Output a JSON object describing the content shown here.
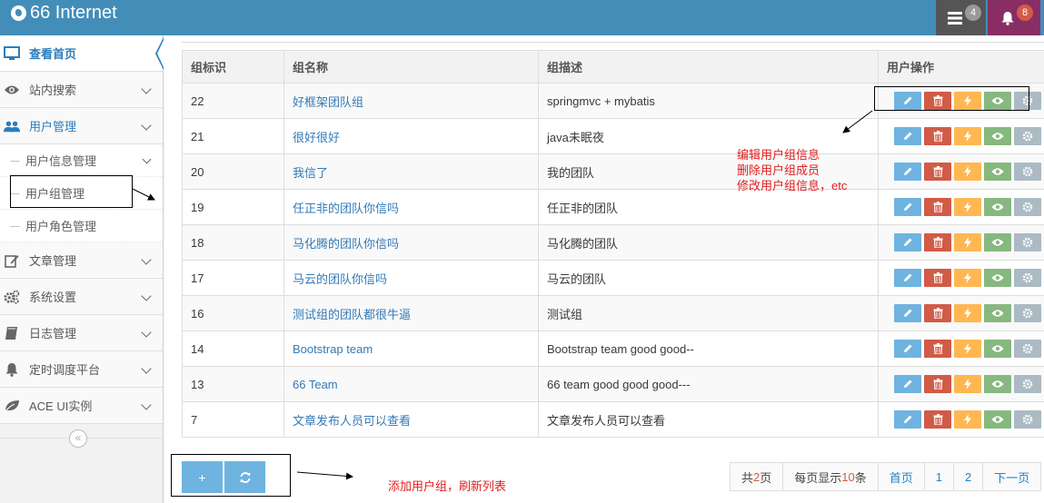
{
  "navbar": {
    "brand": "66 Internet",
    "tasks_badge": "4",
    "alerts_badge": "8",
    "colors": {
      "bar": "#438eb9",
      "tasks": "#555555",
      "alerts": "#892e65"
    }
  },
  "sidebar": {
    "items": [
      {
        "label": "查看首页",
        "icon": "monitor-icon"
      },
      {
        "label": "站内搜索",
        "icon": "eye-icon"
      },
      {
        "label": "用户管理",
        "icon": "users-icon"
      },
      {
        "label": "用户信息管理"
      },
      {
        "label": "用户组管理"
      },
      {
        "label": "用户角色管理"
      },
      {
        "label": "文章管理",
        "icon": "edit-icon"
      },
      {
        "label": "系统设置",
        "icon": "cogs-icon"
      },
      {
        "label": "日志管理",
        "icon": "book-icon"
      },
      {
        "label": "定时调度平台",
        "icon": "bell-icon"
      },
      {
        "label": "ACE UI实例",
        "icon": "leaf-icon"
      }
    ],
    "collapse_glyph": "«"
  },
  "table": {
    "headers": [
      "组标识",
      "组名称",
      "组描述",
      "用户操作"
    ],
    "rows": [
      {
        "id": "22",
        "name": "好框架团队组",
        "desc": "springmvc + mybatis"
      },
      {
        "id": "21",
        "name": "很好很好",
        "desc": "java未眠夜"
      },
      {
        "id": "20",
        "name": "我信了",
        "desc": "我的团队"
      },
      {
        "id": "19",
        "name": "任正非的团队你信吗",
        "desc": "任正非的团队"
      },
      {
        "id": "18",
        "name": "马化腾的团队你信吗",
        "desc": "马化腾的团队"
      },
      {
        "id": "17",
        "name": "马云的团队你信吗",
        "desc": "马云的团队"
      },
      {
        "id": "16",
        "name": "测试组的团队都很牛逼",
        "desc": "测试组"
      },
      {
        "id": "14",
        "name": "Bootstrap team",
        "desc": "Bootstrap team good good--"
      },
      {
        "id": "13",
        "name": "66 Team",
        "desc": "66 team good good good---"
      },
      {
        "id": "7",
        "name": "文章发布人员可以查看",
        "desc": "文章发布人员可以查看"
      }
    ],
    "action_colors": {
      "edit": "#6fb3e0",
      "delete": "#d15b47",
      "bolt": "#ffb752",
      "view": "#87b87f",
      "settings": "#abbac3"
    }
  },
  "toolbar": {
    "add_glyph": "+",
    "refresh_icon": "refresh-icon"
  },
  "pager": {
    "total_prefix": "共",
    "total_pages": "2",
    "total_suffix": "页",
    "per_page_prefix": "每页显示",
    "per_page": "10",
    "per_page_suffix": "条",
    "first": "首页",
    "page1": "1",
    "page2": "2",
    "next": "下一页"
  },
  "annotations": {
    "actions_line1": "编辑用户组信息",
    "actions_line2": "删除用户组成员",
    "actions_line3": "修改用户组信息，etc",
    "toolbar": "添加用户组，刷新列表"
  }
}
